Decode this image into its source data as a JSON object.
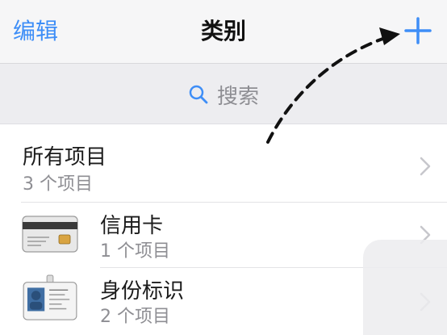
{
  "nav": {
    "edit_label": "编辑",
    "title": "类别"
  },
  "search": {
    "placeholder": "搜索"
  },
  "rows": [
    {
      "title": "所有项目",
      "subtitle": "3 个项目"
    },
    {
      "title": "信用卡",
      "subtitle": "1 个项目"
    },
    {
      "title": "身份标识",
      "subtitle": "2 个项目"
    }
  ],
  "colors": {
    "accent": "#3e8ef7",
    "secondary_text": "#8e8e93"
  }
}
